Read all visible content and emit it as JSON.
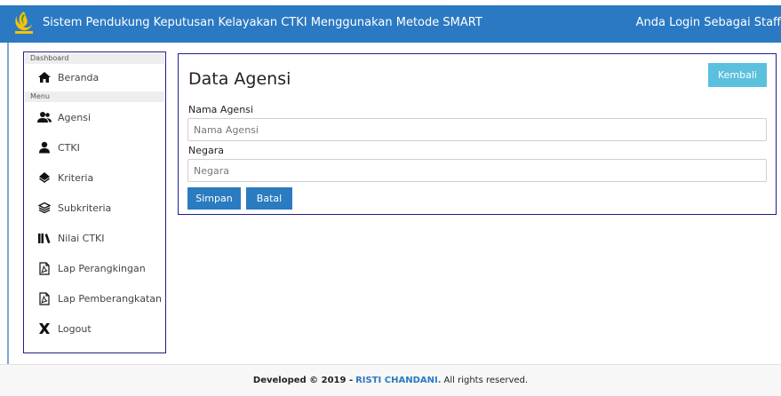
{
  "header": {
    "title": "Sistem Pendukung Keputusan Kelayakan CTKI Menggunakan Metode SMART",
    "login_text": "Anda Login Sebagai Staff"
  },
  "sidebar": {
    "section_dashboard": "Dashboard",
    "section_menu": "Menu",
    "items": [
      {
        "label": "Beranda",
        "icon": "home-icon"
      },
      {
        "label": "Agensi",
        "icon": "users-icon"
      },
      {
        "label": "CTKI",
        "icon": "user-icon"
      },
      {
        "label": "Kriteria",
        "icon": "diamond-icon"
      },
      {
        "label": "Subkriteria",
        "icon": "layers-icon"
      },
      {
        "label": "Nilai CTKI",
        "icon": "library-icon"
      },
      {
        "label": "Lap Perangkingan",
        "icon": "pdf-file-icon"
      },
      {
        "label": "Lap Pemberangkatan",
        "icon": "pdf-file-icon"
      },
      {
        "label": "Logout",
        "icon": "close-icon"
      }
    ]
  },
  "form": {
    "title": "Data Agensi",
    "back_label": "Kembali",
    "nama_label": "Nama Agensi",
    "nama_placeholder": "Nama Agensi",
    "negara_label": "Negara",
    "negara_placeholder": "Negara",
    "save_label": "Simpan",
    "cancel_label": "Batal"
  },
  "footer": {
    "developed": "Developed © 2019 -",
    "author": "RISTI CHANDANI.",
    "rights": "All rights reserved."
  },
  "colors": {
    "header_bg": "#2b79c3",
    "primary_button": "#2b7bc0",
    "info_button": "#5bc0de",
    "panel_border": "#1f1f8f"
  }
}
